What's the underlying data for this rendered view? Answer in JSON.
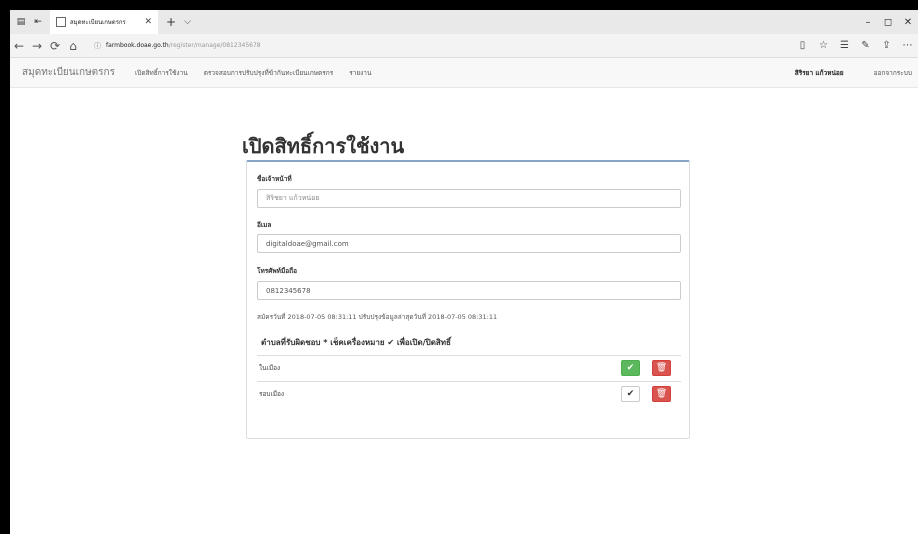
{
  "browser": {
    "tab_title": "สมุดทะเบียนเกษตรกร",
    "url_host": "farmbook.doae.go.th",
    "url_path": "/register/manage/0812345678"
  },
  "icons": {
    "tab_actions": [
      "tab-list-icon",
      "tab-back-icon"
    ],
    "favicon": "page-icon",
    "new_tab": "+",
    "tab_menu": "⌵",
    "window": [
      "–",
      "◻",
      "✕"
    ],
    "nav": [
      "←",
      "→",
      "⟳",
      "⌂"
    ],
    "right": [
      "reading-view-icon",
      "star-icon",
      "favorites-icon",
      "pen-icon",
      "share-icon",
      "more-icon"
    ]
  },
  "navbar": {
    "brand": "สมุดทะเบียนเกษตรกร",
    "links": [
      "เปิดสิทธิ์การใช้งาน",
      "ตรวจสอบการปรับปรุงที่ข้ากันทะเบียนเกษตรกร",
      "รายงาน"
    ],
    "user": "สิริรยา แก้วหน่อย",
    "logout": "ออกจากระบบ"
  },
  "page": {
    "title": "เปิดสิทธิ์การใช้งาน",
    "officer_label": "ชื่อเจ้าหน้าที่",
    "officer_value": "สิริชยา แก้วหน่อย",
    "email_label": "อีเมล",
    "email_value": "digitaldoae@gmail.com",
    "phone_label": "โทรศัพท์มือถือ",
    "phone_value": "0812345678",
    "meta": "สมัครวันที่ 2018-07-05 08:31:11 ปรับปรุงข้อมูลล่าสุดวันที่ 2018-07-05 08:31:11",
    "section_heading": "ตำบลที่รับผิดชอบ * เช็คเครื่องหมาย ✔ เพื่อเปิด/ปิดสิทธิ์",
    "subdistricts": [
      {
        "name": "ในเมือง",
        "enabled": true
      },
      {
        "name": "รอบเมือง",
        "enabled": false
      }
    ]
  },
  "colors": {
    "enabled_button": "#5cb85c",
    "delete_button": "#d9534f"
  }
}
